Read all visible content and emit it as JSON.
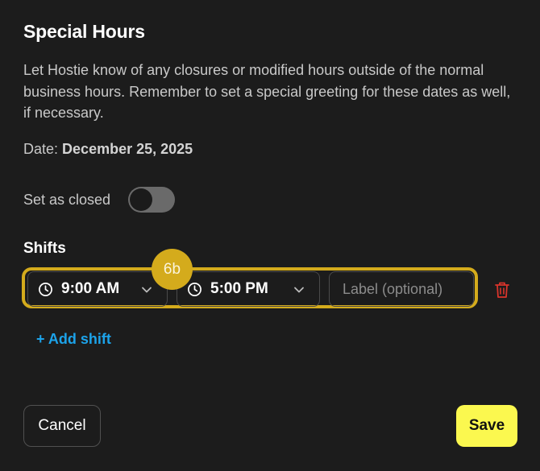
{
  "dialog": {
    "title": "Special Hours",
    "description": "Let Hostie know of any closures or modified hours outside of the normal business hours. Remember to set a special greeting for these dates as well, if necessary.",
    "date_label": "Date:",
    "date_value": "December 25, 2025",
    "closed_label": "Set as closed",
    "closed_toggle_on": false
  },
  "shifts": {
    "heading": "Shifts",
    "items": [
      {
        "start_time": "9:00 AM",
        "end_time": "5:00 PM",
        "label_value": "",
        "label_placeholder": "Label (optional)"
      }
    ],
    "add_label": "+ Add shift"
  },
  "annotation": {
    "badge_text": "6b"
  },
  "footer": {
    "cancel_label": "Cancel",
    "save_label": "Save"
  },
  "icons": {
    "clock": "clock-icon",
    "chevron": "chevron-down-icon",
    "trash": "trash-icon"
  },
  "colors": {
    "background": "#1c1c1c",
    "highlight": "#d4ab1c",
    "link": "#1ca3ea",
    "save_button": "#fbf84f",
    "delete_icon": "#d9342b",
    "toggle_off": "#6a6a6a"
  }
}
